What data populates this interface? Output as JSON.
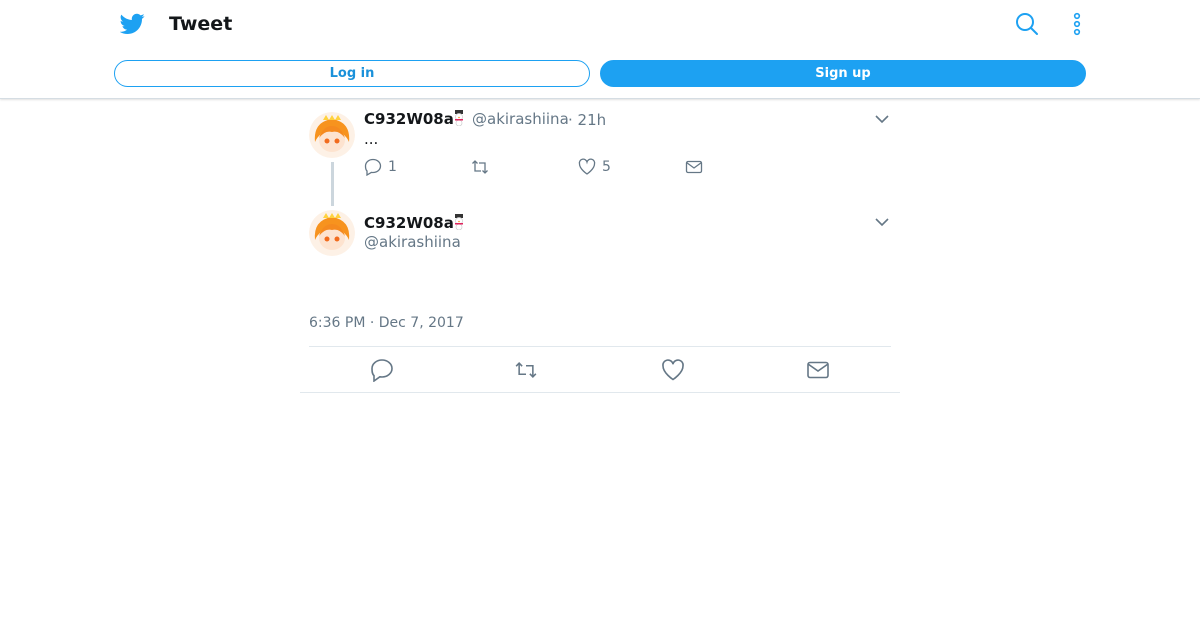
{
  "header": {
    "title": "Tweet",
    "login_label": "Log in",
    "signup_label": "Sign up",
    "icons": [
      "twitter-bird-icon",
      "search-icon",
      "more-vertical-icon"
    ],
    "accent_color": "#1da1f2"
  },
  "tweet_reply": {
    "name": "C932W08a",
    "handle": "@akirashiina",
    "time": "· 21h",
    "text": "...",
    "reply_count": "1",
    "like_count": "5"
  },
  "tweet_main": {
    "name": "C932W08a",
    "handle": "@akirashiina",
    "timestamp": "6:36 PM · Dec 7, 2017"
  }
}
